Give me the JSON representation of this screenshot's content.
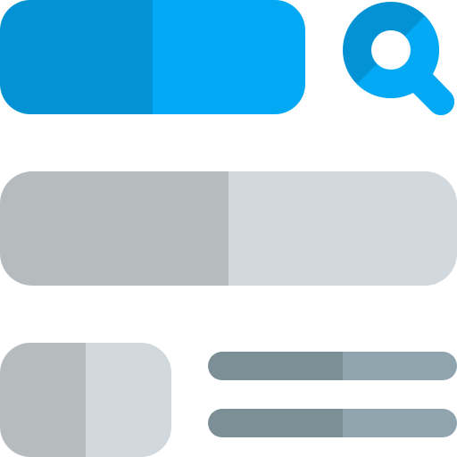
{
  "icon": {
    "name": "search-results-layout-icon",
    "parts": {
      "search_bar": "search-bar-shape",
      "search_button": "search-icon",
      "result_banner": "result-banner-shape",
      "thumbnail": "thumbnail-shape",
      "text_lines": "text-line-shape"
    }
  },
  "colors": {
    "blue_dark": "#0393D4",
    "blue_light": "#03A9F4",
    "gray_dark": "#B6BCBE",
    "gray_light": "#D1D9DE",
    "line_dark": "#7D8F96",
    "line_light": "#90A4AE",
    "background": "#FFFFFF"
  }
}
